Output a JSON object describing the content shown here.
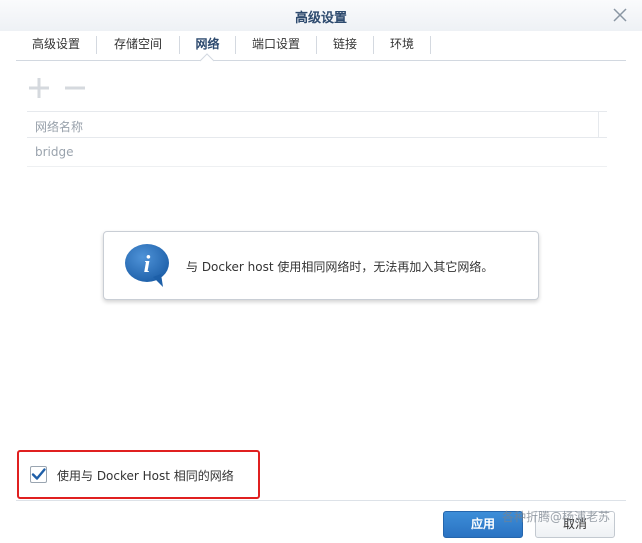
{
  "window": {
    "title": "高级设置"
  },
  "tabs": [
    {
      "label": "高级设置"
    },
    {
      "label": "存储空间"
    },
    {
      "label": "网络"
    },
    {
      "label": "端口设置"
    },
    {
      "label": "链接"
    },
    {
      "label": "环境"
    }
  ],
  "active_tab": "网络",
  "network_table": {
    "columns": [
      "网络名称"
    ],
    "rows": [
      {
        "name": "bridge"
      }
    ]
  },
  "info_message": "与 Docker host 使用相同网络时，无法再加入其它网络。",
  "host_network_option": {
    "label": "使用与 Docker Host 相同的网络",
    "checked": true
  },
  "buttons": {
    "apply": "应用",
    "cancel": "取消"
  },
  "watermark": "各种折腾@杨浦老苏",
  "colors": {
    "accent": "#2a72c2",
    "highlight_border": "#e02020",
    "title": "#2d4a6e"
  },
  "icons": {
    "close": "close-icon",
    "add": "plus-icon",
    "remove": "minus-icon",
    "info": "info-icon",
    "check": "checkmark-icon"
  }
}
